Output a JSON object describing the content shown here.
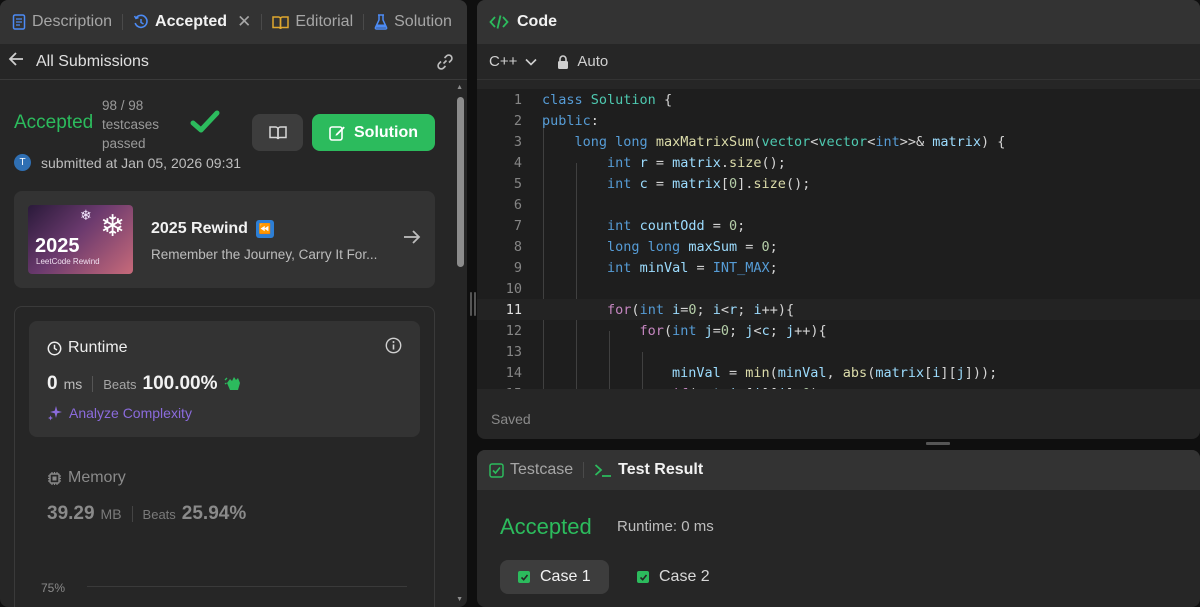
{
  "left_panel": {
    "tabs": [
      {
        "label": "Description",
        "icon": "document-icon"
      },
      {
        "label": "Accepted",
        "icon": "history-icon"
      },
      {
        "label": "Editorial",
        "icon": "book-icon"
      },
      {
        "label": "Solution",
        "icon": "flask-icon"
      }
    ],
    "back_label": "All Submissions",
    "submission": {
      "status": "Accepted",
      "passed_count": "98 / 98",
      "passed_label": "testcases passed",
      "solution_button": "Solution",
      "avatar_letter": "T",
      "submitted_text": "submitted at Jan 05, 2026 09:31"
    },
    "rewind": {
      "image_year": "2025",
      "image_caption": "LeetCode Rewind",
      "title": "2025 Rewind",
      "badge": "⏪",
      "description": "Remember the Journey, Carry It For..."
    },
    "runtime": {
      "title": "Runtime",
      "value": "0",
      "unit": "ms",
      "beats_label": "Beats",
      "beats_pct": "100.00%",
      "analyze_label": "Analyze Complexity"
    },
    "memory": {
      "title": "Memory",
      "value": "39.29",
      "unit": "MB",
      "beats_label": "Beats",
      "beats_pct": "25.94%"
    },
    "chart_tick": "75%"
  },
  "code_panel": {
    "title": "Code",
    "language": "C++",
    "mode": "Auto",
    "saved_label": "Saved",
    "current_line": 11
  },
  "result_panel": {
    "tabs": [
      {
        "label": "Testcase"
      },
      {
        "label": "Test Result"
      }
    ],
    "status": "Accepted",
    "runtime_text": "Runtime: 0 ms",
    "cases": [
      "Case 1",
      "Case 2"
    ]
  },
  "colors": {
    "accent_green": "#2cbb5d",
    "panel_bg": "#262626",
    "header_bg": "#333333",
    "purple": "#8b6bdc"
  }
}
